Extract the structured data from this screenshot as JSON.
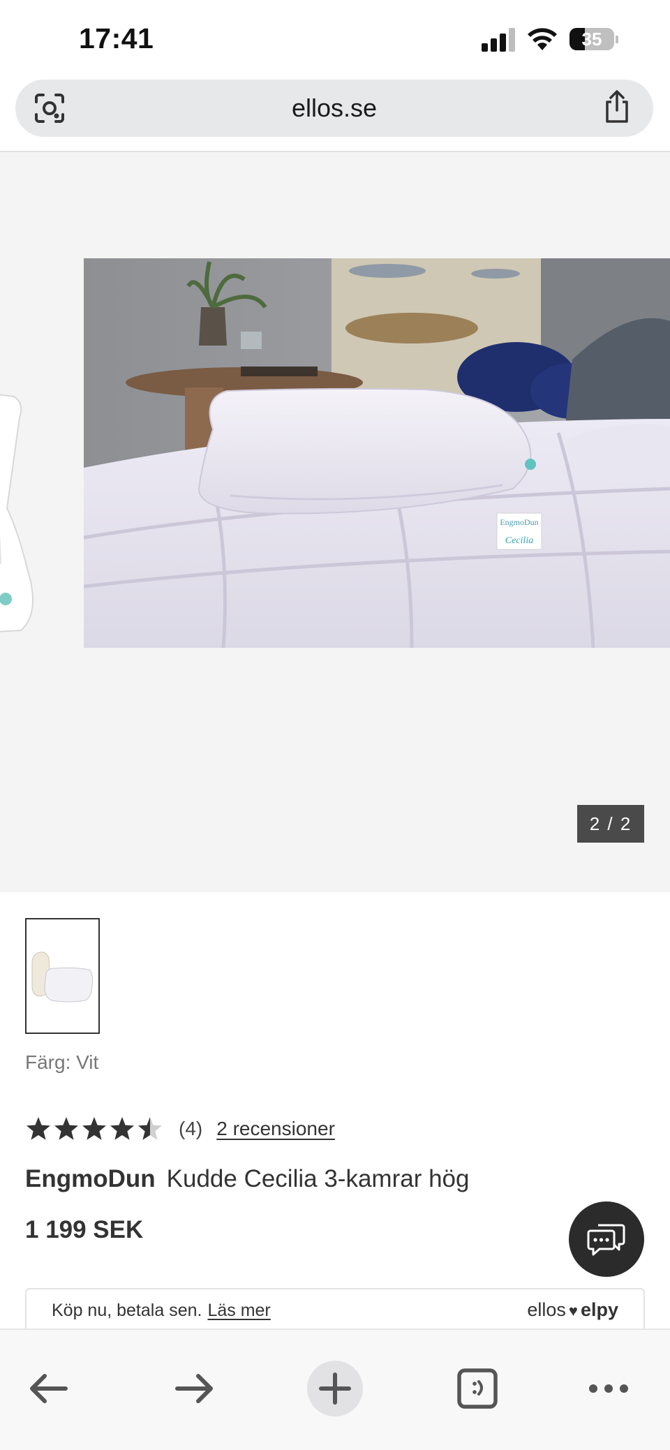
{
  "status_bar": {
    "time": "17:41",
    "battery": "35",
    "battery_level": 0.35
  },
  "browser": {
    "url": "ellos.se"
  },
  "gallery": {
    "counter": "2 / 2"
  },
  "product": {
    "color_label": "Färg: Vit",
    "rating": 4.5,
    "rating_count": "(4)",
    "reviews_link": "2 recensioner",
    "brand": "EngmoDun",
    "name": "Kudde Cecilia 3-kamrar hög",
    "price": "1 199 SEK"
  },
  "payment": {
    "text": "Köp nu, betala sen.",
    "link": "Läs mer",
    "logo_left": "ellos",
    "logo_right": "elpy"
  },
  "product_image": {
    "tag_text": "Cecilia",
    "tag_brand": "EngmoDun"
  },
  "toolbar": {
    "icons": [
      "back-arrow-icon",
      "forward-arrow-icon",
      "plus-icon",
      "tabs-icon",
      "more-icon"
    ]
  },
  "colors": {
    "accent_dark": "#2b2b2b",
    "counter_bg": "#4a4a4a",
    "gallery_bg": "#f4f4f4"
  }
}
